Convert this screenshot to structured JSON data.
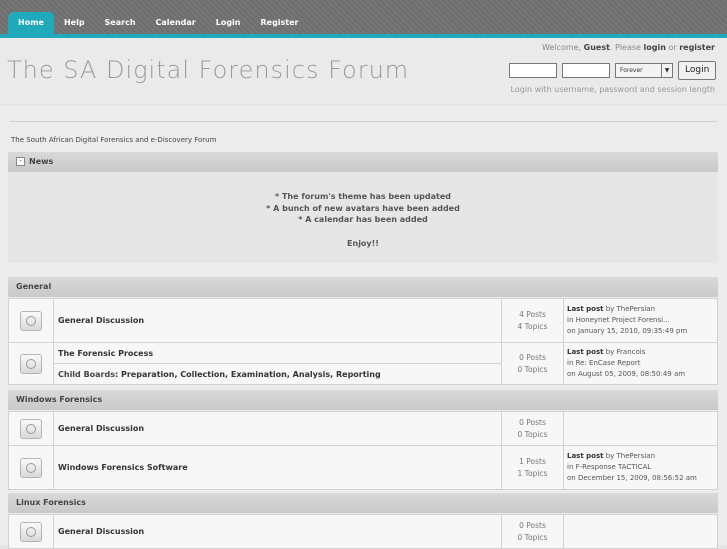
{
  "nav": {
    "items": [
      {
        "label": "Home",
        "active": true
      },
      {
        "label": "Help"
      },
      {
        "label": "Search"
      },
      {
        "label": "Calendar"
      },
      {
        "label": "Login"
      },
      {
        "label": "Register"
      }
    ]
  },
  "header": {
    "title": "The SA Digital Forensics Forum",
    "welcome_prefix": "Welcome,",
    "welcome_guest": "Guest",
    "welcome_mid": ". Please",
    "welcome_login": "login",
    "welcome_or": "or",
    "welcome_register": "register",
    "session_select": "Forever",
    "login_button": "Login",
    "login_hint": "Login with username, password and session length"
  },
  "subtitle": "The South African Digital Forensics and e-Discovery Forum",
  "news": {
    "title": "News",
    "lines": [
      "* The forum's theme has been updated",
      "* A bunch of new avatars have been added",
      "* A calendar has been added",
      "",
      "Enjoy!!"
    ]
  },
  "categories": [
    {
      "name": "General",
      "boards": [
        {
          "name": "General Discussion",
          "posts": "4 Posts",
          "topics": "4 Topics",
          "last_label": "Last post",
          "last_by": "by ThePersian",
          "last_in": "in Honeynet Project Forensi...",
          "last_on": "on January 15, 2010, 09:35:49 pm"
        },
        {
          "name": "The Forensic Process",
          "posts": "0 Posts",
          "topics": "0 Topics",
          "child_label": "Child Boards",
          "child_boards": ": Preparation, Collection, Examination, Analysis, Reporting",
          "last_label": "Last post",
          "last_by": "by Francois",
          "last_in": "in Re: EnCase Report",
          "last_on": "on August 05, 2009, 08:50:49 am"
        }
      ]
    },
    {
      "name": "Windows Forensics",
      "boards": [
        {
          "name": "General Discussion",
          "posts": "0 Posts",
          "topics": "0 Topics"
        },
        {
          "name": "Windows Forensics Software",
          "posts": "1 Posts",
          "topics": "1 Topics",
          "last_label": "Last post",
          "last_by": "by ThePersian",
          "last_in": "in F-Response TACTICAL",
          "last_on": "on December 15, 2009, 08:56:52 am"
        }
      ]
    },
    {
      "name": "Linux Forensics",
      "boards": [
        {
          "name": "General Discussion",
          "posts": "0 Posts",
          "topics": "0 Topics"
        }
      ]
    }
  ]
}
